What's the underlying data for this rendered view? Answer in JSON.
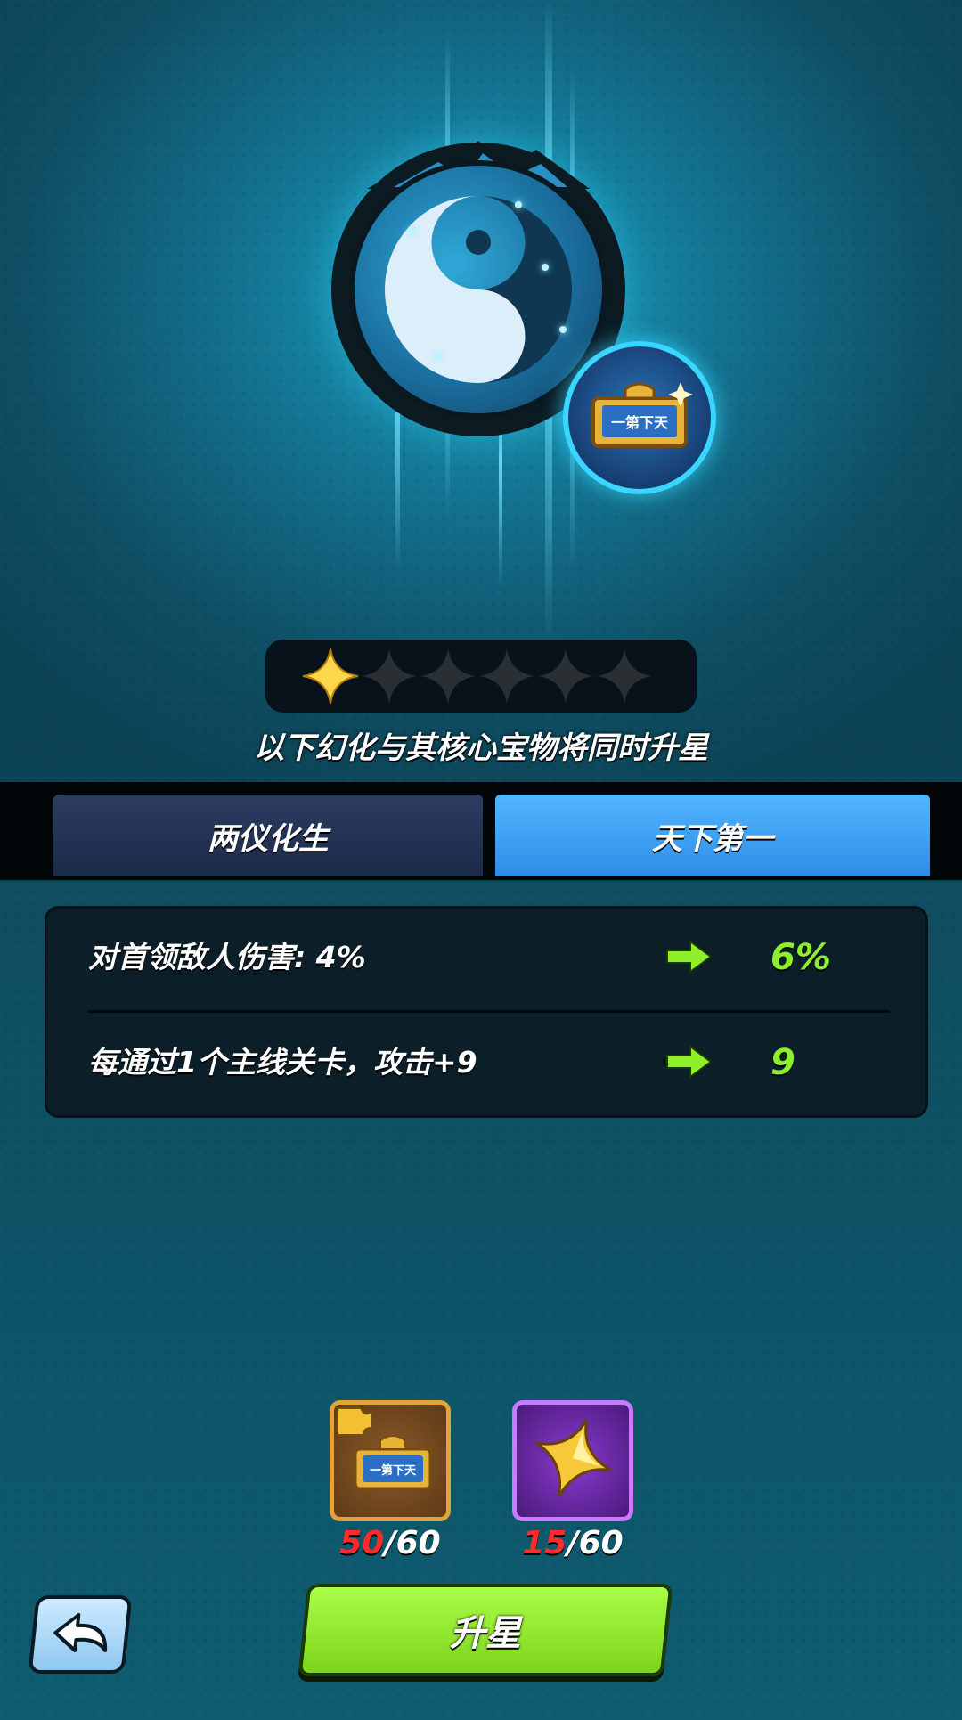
{
  "hero": {
    "main_icon": "yin-yang-icon",
    "badge_icon": "plaque-icon",
    "badge_plaque_text": "一第下天",
    "star_rating": {
      "filled": 1,
      "total": 6
    }
  },
  "subtitle": "以下幻化与其核心宝物将同时升星",
  "tabs": [
    {
      "label": "两仪化生",
      "active": false
    },
    {
      "label": "天下第一",
      "active": true
    }
  ],
  "stats": [
    {
      "label": "对首领敌人伤害: 4%",
      "arrow_icon": "arrow-right-icon",
      "value": "6%"
    },
    {
      "label": "每通过1个主线关卡，攻击+9",
      "arrow_icon": "arrow-right-icon",
      "value": "9"
    }
  ],
  "materials": [
    {
      "icon": "plaque-fragment-icon",
      "plaque_text": "一第下天",
      "have": "50",
      "sep": "/",
      "need": "60"
    },
    {
      "icon": "gold-star-icon",
      "have": "15",
      "sep": "/",
      "need": "60"
    }
  ],
  "back_button": {
    "icon": "back-arrow-icon"
  },
  "upgrade_button": {
    "label": "升星"
  },
  "colors": {
    "active_tab": "#2d8de6",
    "inactive_tab": "#1c2a48",
    "stat_value": "#8ef02a",
    "count_have": "#ff2a2a",
    "upgrade_button": "#7ed31c",
    "badge_ring": "#39d7ff"
  }
}
